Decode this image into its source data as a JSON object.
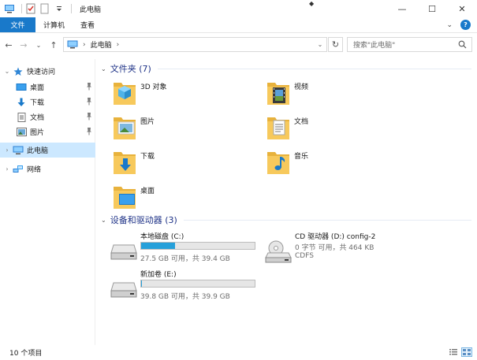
{
  "window": {
    "title": "此电脑",
    "minimize_glyph": "—",
    "maximize_glyph": "☐",
    "close_glyph": "✕"
  },
  "ribbon": {
    "tabs": [
      "文件",
      "计算机",
      "查看"
    ],
    "expand_glyph": "⌄",
    "help_glyph": "?"
  },
  "address": {
    "back_glyph": "←",
    "forward_glyph": "→",
    "dropdown_glyph": "⌄",
    "up_glyph": "↑",
    "crumb_sep_glyph": "›",
    "location": "此电脑",
    "trail_sep_glyph": "›",
    "refresh_glyph": "↻",
    "search_placeholder": "搜索\"此电脑\""
  },
  "nav": {
    "quick_access": "快速访问",
    "quick_items": [
      "桌面",
      "下载",
      "文档",
      "图片"
    ],
    "this_pc": "此电脑",
    "network": "网络",
    "collapse_glyph": "⌄",
    "expand_glyph": "›"
  },
  "folders_group": {
    "title": "文件夹 (7)",
    "items": [
      {
        "name": "3D 对象",
        "icon": "3d-objects-folder-icon"
      },
      {
        "name": "视频",
        "icon": "videos-folder-icon"
      },
      {
        "name": "图片",
        "icon": "pictures-folder-icon"
      },
      {
        "name": "文档",
        "icon": "documents-folder-icon"
      },
      {
        "name": "下载",
        "icon": "downloads-folder-icon"
      },
      {
        "name": "音乐",
        "icon": "music-folder-icon"
      },
      {
        "name": "桌面",
        "icon": "desktop-folder-icon"
      }
    ]
  },
  "drives_group": {
    "title": "设备和驱动器 (3)",
    "items": [
      {
        "name": "本地磁盘 (C:)",
        "info": "27.5 GB 可用，共 39.4 GB",
        "fs": "",
        "used_fraction": 0.3,
        "has_bar": true
      },
      {
        "name": "CD 驱动器 (D:) config-2",
        "info": "0 字节 可用，共 464 KB",
        "fs": "CDFS",
        "has_bar": false
      },
      {
        "name": "新加卷 (E:)",
        "info": "39.8 GB 可用，共 39.9 GB",
        "fs": "",
        "used_fraction": 0.003,
        "has_bar": true
      }
    ]
  },
  "status": {
    "count": "10 个项目"
  },
  "colors": {
    "accent": "#1979ca",
    "folder": "#f7c95c",
    "drive_bar": "#26a0da",
    "selected": "#cce8ff",
    "group_title": "#1e3287"
  }
}
